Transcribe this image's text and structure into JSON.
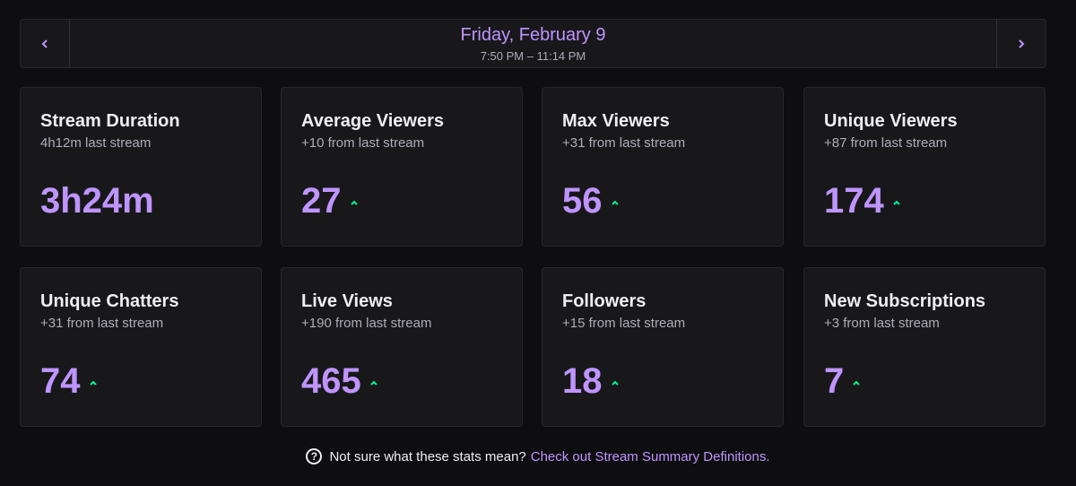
{
  "header": {
    "prev_icon": "chevron-left-icon",
    "next_icon": "chevron-right-icon",
    "date": "Friday, February 9",
    "time_range": "7:50 PM – 11:14 PM"
  },
  "colors": {
    "accent": "#bf94ff",
    "trend_up": "#00f593",
    "card_bg": "#18181b",
    "page_bg": "#0e0e10"
  },
  "stats": [
    {
      "title": "Stream Duration",
      "subtitle": "4h12m last stream",
      "value": "3h24m",
      "trend": "none"
    },
    {
      "title": "Average Viewers",
      "subtitle": "+10 from last stream",
      "value": "27",
      "trend": "up"
    },
    {
      "title": "Max Viewers",
      "subtitle": "+31 from last stream",
      "value": "56",
      "trend": "up"
    },
    {
      "title": "Unique Viewers",
      "subtitle": "+87 from last stream",
      "value": "174",
      "trend": "up"
    },
    {
      "title": "Unique Chatters",
      "subtitle": "+31 from last stream",
      "value": "74",
      "trend": "up"
    },
    {
      "title": "Live Views",
      "subtitle": "+190 from last stream",
      "value": "465",
      "trend": "up"
    },
    {
      "title": "Followers",
      "subtitle": "+15 from last stream",
      "value": "18",
      "trend": "up"
    },
    {
      "title": "New Subscriptions",
      "subtitle": "+3 from last stream",
      "value": "7",
      "trend": "up"
    }
  ],
  "footer": {
    "help_icon": "question-circle-icon",
    "text": "Not sure what these stats mean?",
    "link": "Check out Stream Summary Definitions."
  }
}
